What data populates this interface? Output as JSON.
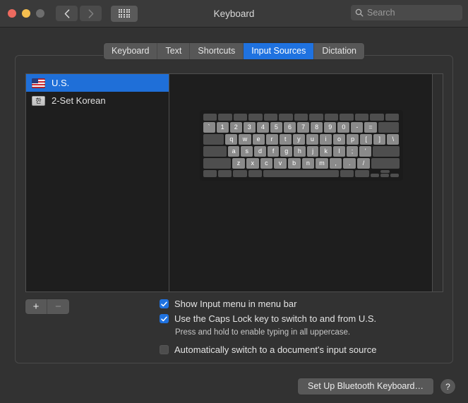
{
  "window": {
    "title": "Keyboard",
    "traffic_lights": [
      "close",
      "minimize",
      "zoom"
    ],
    "nav_back_icon": "chevron-left-icon",
    "nav_forward_icon": "chevron-right-icon",
    "grid_icon": "show-all-preferences-grid-icon",
    "search": {
      "icon": "search-icon",
      "value": "",
      "placeholder": "Search"
    }
  },
  "tabs": [
    {
      "label": "Keyboard",
      "active": false
    },
    {
      "label": "Text",
      "active": false
    },
    {
      "label": "Shortcuts",
      "active": false
    },
    {
      "label": "Input Sources",
      "active": true
    },
    {
      "label": "Dictation",
      "active": false
    }
  ],
  "input_sources": [
    {
      "label": "U.S.",
      "icon": "us-flag-icon",
      "selected": true
    },
    {
      "label": "2-Set Korean",
      "icon": "korean-han-icon",
      "glyph": "한",
      "selected": false
    }
  ],
  "list_buttons": {
    "add_label": "+",
    "remove_label": "−"
  },
  "keyboard_preview": {
    "function_row": [
      "",
      "",
      "",
      "",
      "",
      "",
      "",
      "",
      "",
      "",
      "",
      "",
      ""
    ],
    "number_row": [
      "`",
      "1",
      "2",
      "3",
      "4",
      "5",
      "6",
      "7",
      "8",
      "9",
      "0",
      "-",
      "="
    ],
    "top_row": [
      "q",
      "w",
      "e",
      "r",
      "t",
      "y",
      "u",
      "i",
      "o",
      "p",
      "[",
      "]",
      "\\"
    ],
    "home_row": [
      "a",
      "s",
      "d",
      "f",
      "g",
      "h",
      "j",
      "k",
      "l",
      ";",
      "'"
    ],
    "bottom_row": [
      "z",
      "x",
      "c",
      "v",
      "b",
      "n",
      "m",
      ",",
      ".",
      "/"
    ]
  },
  "options": [
    {
      "label": "Show Input menu in menu bar",
      "checked": true,
      "name": "show-input-menu-checkbox"
    },
    {
      "label": "Use the Caps Lock key to switch to and from U.S.",
      "checked": true,
      "name": "caps-lock-switch-checkbox",
      "hint": "Press and hold to enable typing in all uppercase."
    },
    {
      "label": "Automatically switch to a document's input source",
      "checked": false,
      "name": "auto-switch-document-checkbox"
    }
  ],
  "footer": {
    "bluetooth_button": "Set Up Bluetooth Keyboard…",
    "help_button": "?"
  },
  "colors": {
    "accent": "#1f72e0",
    "window_bg": "#323232",
    "panel_bg": "#1e1e1e",
    "titlebar_bg": "#3a3a3a"
  }
}
